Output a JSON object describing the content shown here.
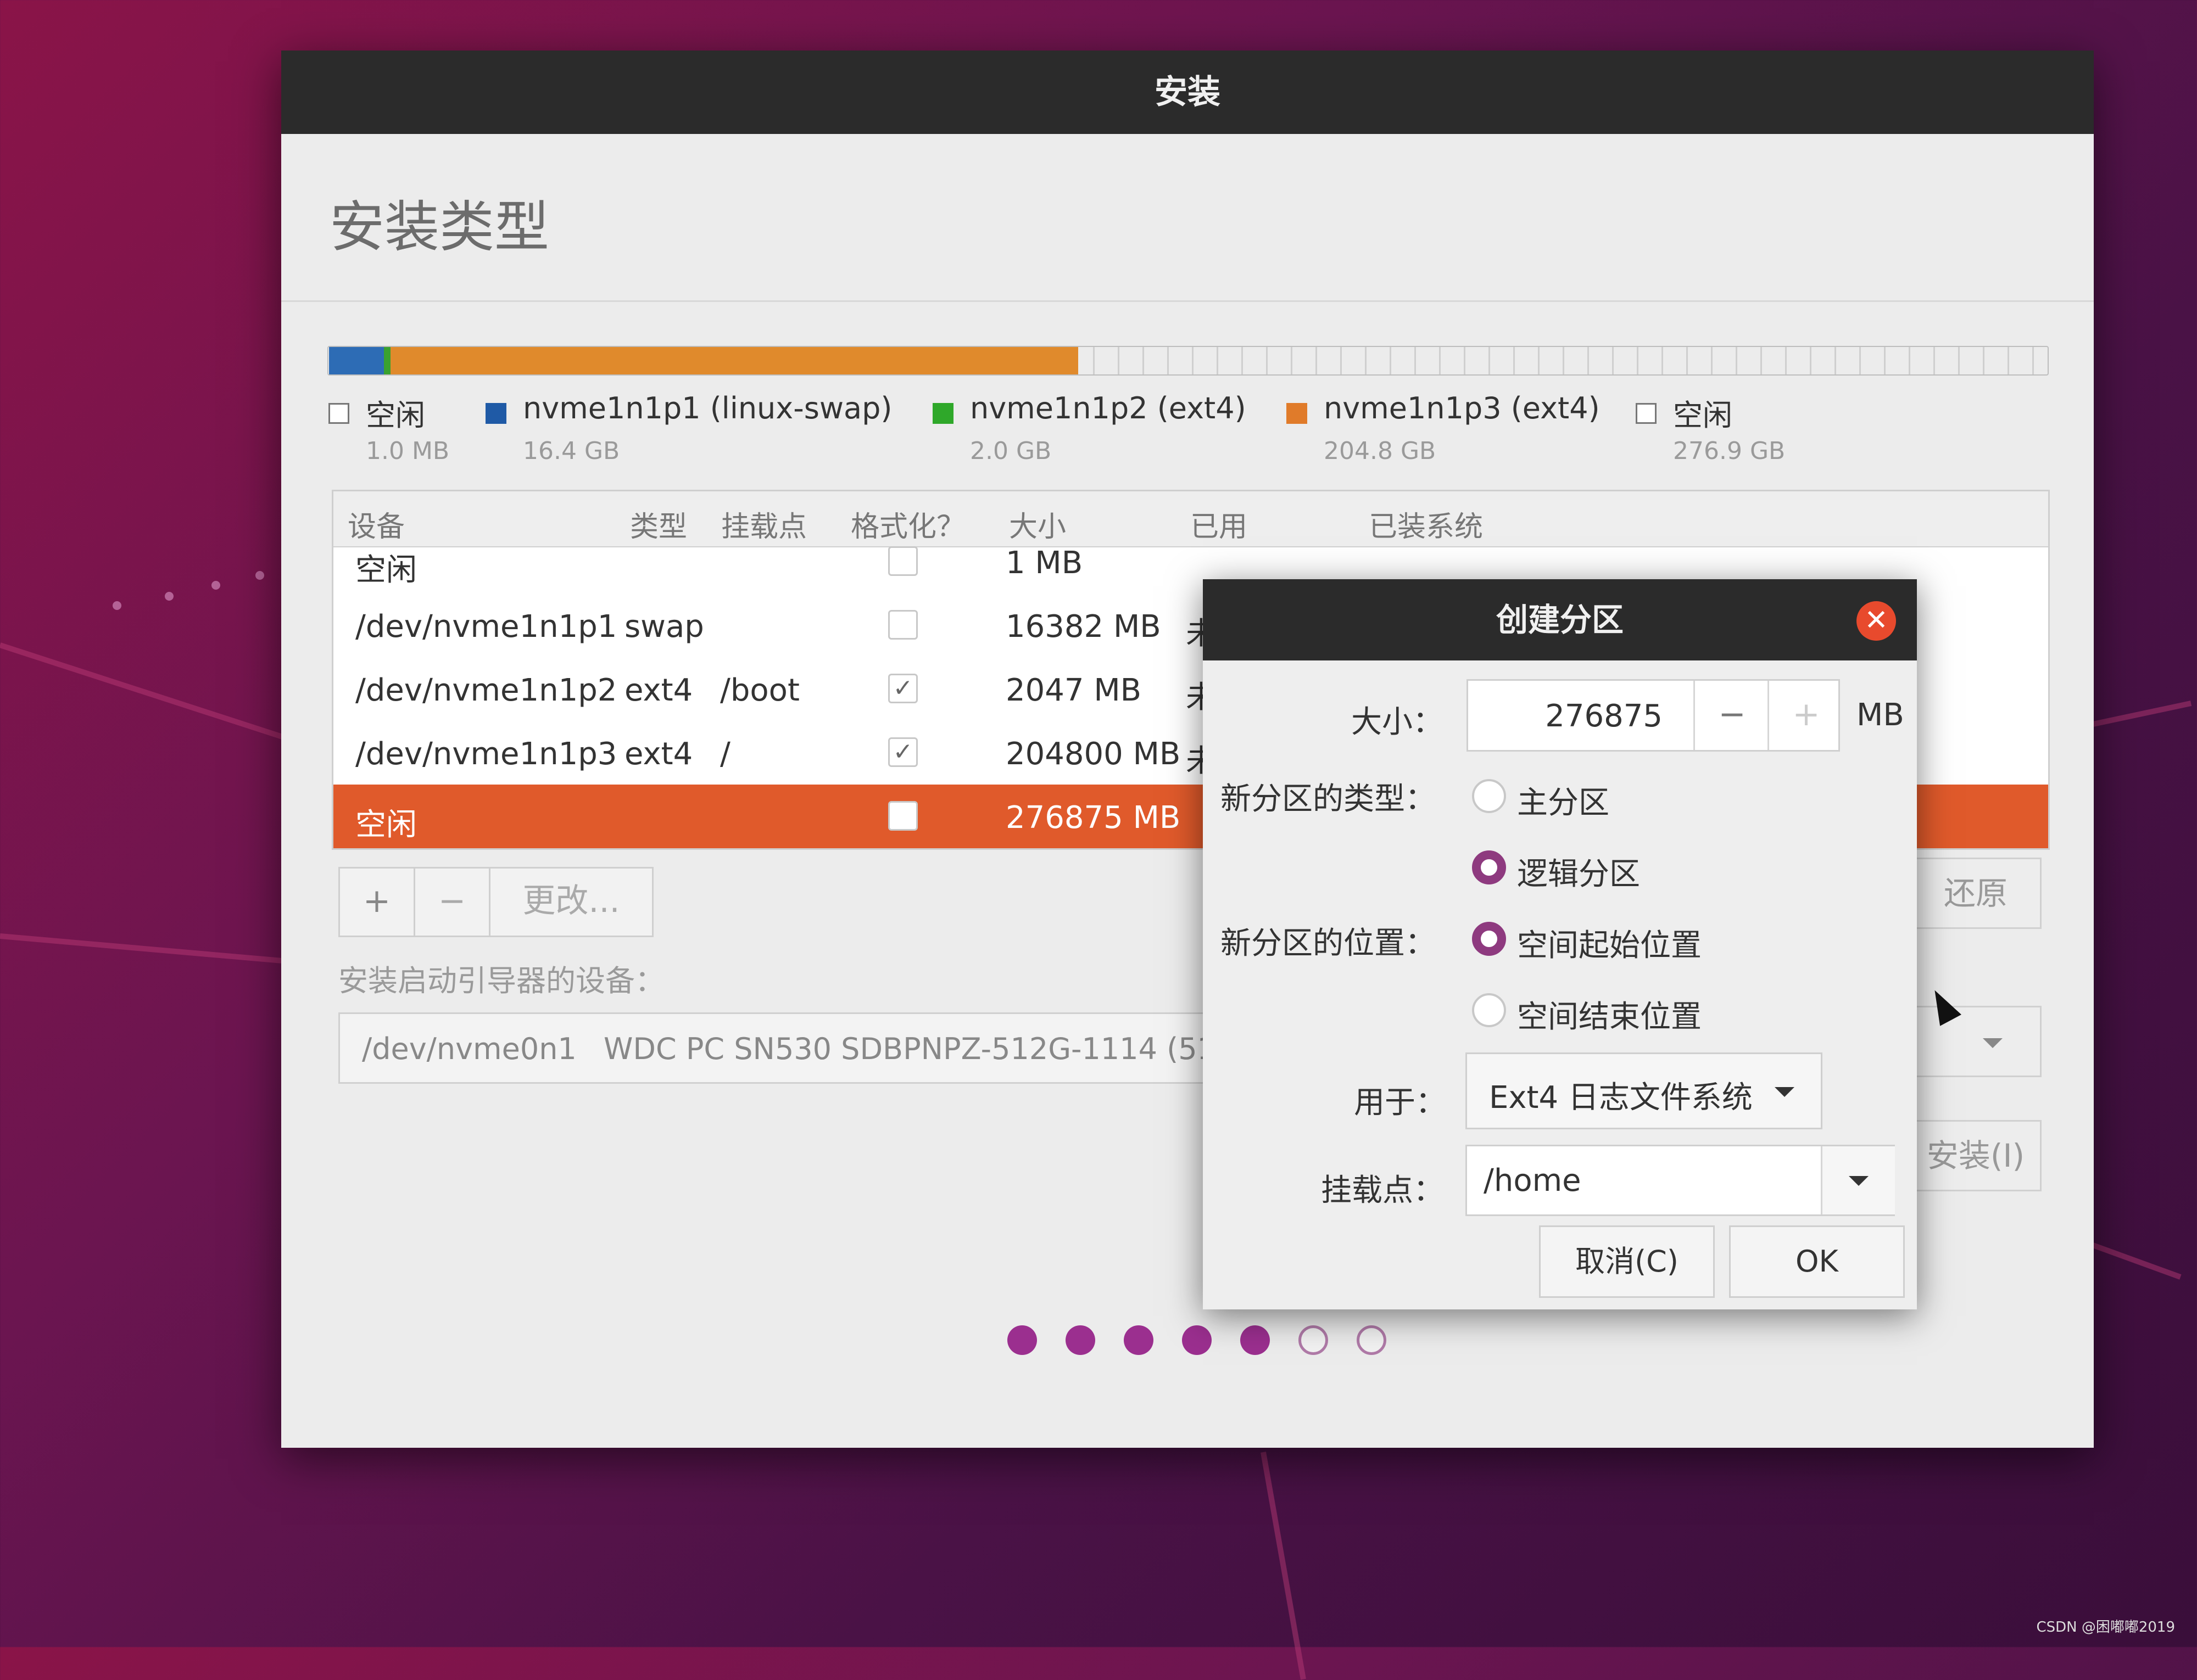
{
  "window": {
    "title": "安装",
    "heading": "安装类型"
  },
  "disk_segments": [
    {
      "name": "空闲",
      "fraction": 0.0002,
      "color": "#ffffff"
    },
    {
      "name": "nvme1n1p1 (linux-swap)",
      "fraction": 0.032,
      "color": "#2d6cb5"
    },
    {
      "name": "nvme1n1p2 (ext4)",
      "fraction": 0.004,
      "color": "#3aa12f"
    },
    {
      "name": "nvme1n1p3 (ext4)",
      "fraction": 0.4,
      "color": "#e08a2c"
    },
    {
      "name": "空闲",
      "fraction": 0.5638,
      "color": "#e6e6e6"
    }
  ],
  "legend": [
    {
      "label": "空闲",
      "size": "1.0 MB",
      "color": "#ffffff"
    },
    {
      "label": "nvme1n1p1 (linux-swap)",
      "size": "16.4 GB",
      "color": "#1f5aa6"
    },
    {
      "label": "nvme1n1p2 (ext4)",
      "size": "2.0 GB",
      "color": "#2fa82a"
    },
    {
      "label": "nvme1n1p3 (ext4)",
      "size": "204.8 GB",
      "color": "#e07b2a"
    },
    {
      "label": "空闲",
      "size": "276.9 GB",
      "color": "#ffffff"
    }
  ],
  "table": {
    "headers": [
      "设备",
      "类型",
      "挂载点",
      "格式化？",
      "大小",
      "已用",
      "已装系统"
    ],
    "rows": [
      {
        "device": "空闲",
        "type": "",
        "mount": "",
        "format": "unchecked",
        "size": "1 MB",
        "used": ""
      },
      {
        "device": "/dev/nvme1n1p1",
        "type": "swap",
        "mount": "",
        "format": "unchecked",
        "size": "16382 MB",
        "used": "未"
      },
      {
        "device": "/dev/nvme1n1p2",
        "type": "ext4",
        "mount": "/boot",
        "format": "checked",
        "size": "2047 MB",
        "used": "未"
      },
      {
        "device": "/dev/nvme1n1p3",
        "type": "ext4",
        "mount": "/",
        "format": "checked",
        "size": "204800 MB",
        "used": "未"
      },
      {
        "device": "空闲",
        "type": "",
        "mount": "",
        "format": "unchecked",
        "size": "276875 MB",
        "used": ""
      }
    ],
    "check_mark": "✓"
  },
  "table_buttons": {
    "add": "+",
    "remove": "−",
    "change": "更改..."
  },
  "revert_label": "还原",
  "boot": {
    "label": "安装启动引导器的设备：",
    "device": "/dev/nvme0n1",
    "model": "WDC PC SN530 SDBPNPZ-512G-1114 (51"
  },
  "install_label": "安装(I)",
  "progress": {
    "total": 7,
    "completed": 5
  },
  "dialog": {
    "title": "创建分区",
    "close": "✕",
    "size_label": "大小：",
    "size_value": "276875",
    "size_unit": "MB",
    "minus": "−",
    "plus": "+",
    "type_label": "新分区的类型：",
    "type_options": [
      "主分区",
      "逻辑分区"
    ],
    "type_selected": "逻辑分区",
    "location_label": "新分区的位置：",
    "location_options": [
      "空间起始位置",
      "空间结束位置"
    ],
    "location_selected": "空间起始位置",
    "use_label": "用于：",
    "use_value": "Ext4 日志文件系统",
    "mount_label": "挂载点：",
    "mount_value": "/home",
    "cancel": "取消(C)",
    "ok": "OK"
  },
  "watermark": "CSDN @困嘟嘟2019"
}
